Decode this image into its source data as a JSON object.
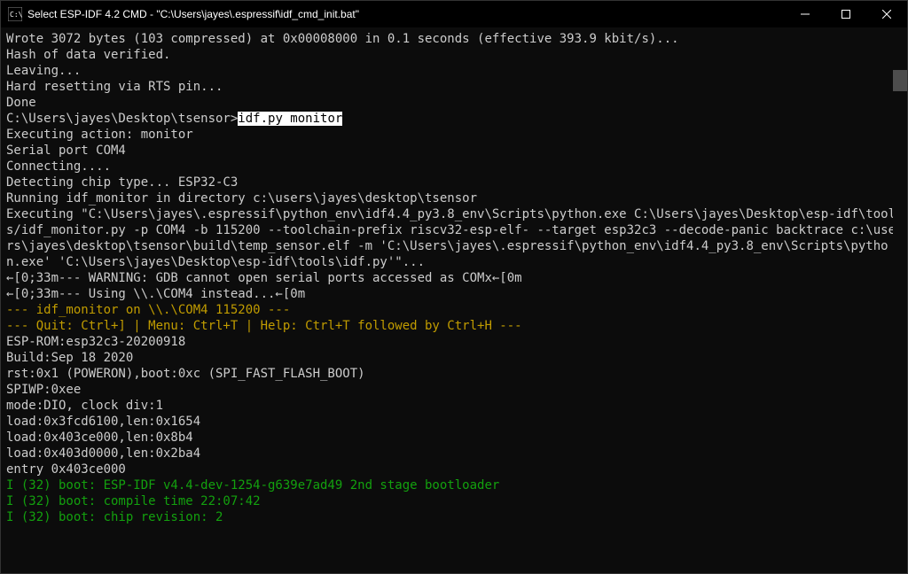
{
  "window": {
    "title": "Select ESP-IDF 4.2 CMD - \"C:\\Users\\jayes\\.espressif\\idf_cmd_init.bat\""
  },
  "term": {
    "l01": "Wrote 3072 bytes (103 compressed) at 0x00008000 in 0.1 seconds (effective 393.9 kbit/s)...",
    "l02": "Hash of data verified.",
    "l03": "",
    "l04": "Leaving...",
    "l05": "Hard resetting via RTS pin...",
    "l06": "Done",
    "l07": "",
    "prompt": "C:\\Users\\jayes\\Desktop\\tsensor>",
    "cmd": "idf.py monitor",
    "l09": "Executing action: monitor",
    "l10": "Serial port COM4",
    "l11": "Connecting....",
    "l12": "Detecting chip type... ESP32-C3",
    "l13": "Running idf_monitor in directory c:\\users\\jayes\\desktop\\tsensor",
    "l14": "Executing \"C:\\Users\\jayes\\.espressif\\python_env\\idf4.4_py3.8_env\\Scripts\\python.exe C:\\Users\\jayes\\Desktop\\esp-idf\\tools/idf_monitor.py -p COM4 -b 115200 --toolchain-prefix riscv32-esp-elf- --target esp32c3 --decode-panic backtrace c:\\users\\jayes\\desktop\\tsensor\\build\\temp_sensor.elf -m 'C:\\Users\\jayes\\.espressif\\python_env\\idf4.4_py3.8_env\\Scripts\\python.exe' 'C:\\Users\\jayes\\Desktop\\esp-idf\\tools\\idf.py'\"...",
    "l15": "←[0;33m--- WARNING: GDB cannot open serial ports accessed as COMx←[0m",
    "l16": "←[0;33m--- Using \\\\.\\COM4 instead...←[0m",
    "l17": "--- idf_monitor on \\\\.\\COM4 115200 ---",
    "l18": "--- Quit: Ctrl+] | Menu: Ctrl+T | Help: Ctrl+T followed by Ctrl+H ---",
    "l19": "ESP-ROM:esp32c3-20200918",
    "l20": "Build:Sep 18 2020",
    "l21": "rst:0x1 (POWERON),boot:0xc (SPI_FAST_FLASH_BOOT)",
    "l22": "SPIWP:0xee",
    "l23": "mode:DIO, clock div:1",
    "l24": "load:0x3fcd6100,len:0x1654",
    "l25": "load:0x403ce000,len:0x8b4",
    "l26": "load:0x403d0000,len:0x2ba4",
    "l27": "entry 0x403ce000",
    "l28": "I (32) boot: ESP-IDF v4.4-dev-1254-g639e7ad49 2nd stage bootloader",
    "l29": "I (32) boot: compile time 22:07:42",
    "l30": "I (32) boot: chip revision: 2"
  }
}
